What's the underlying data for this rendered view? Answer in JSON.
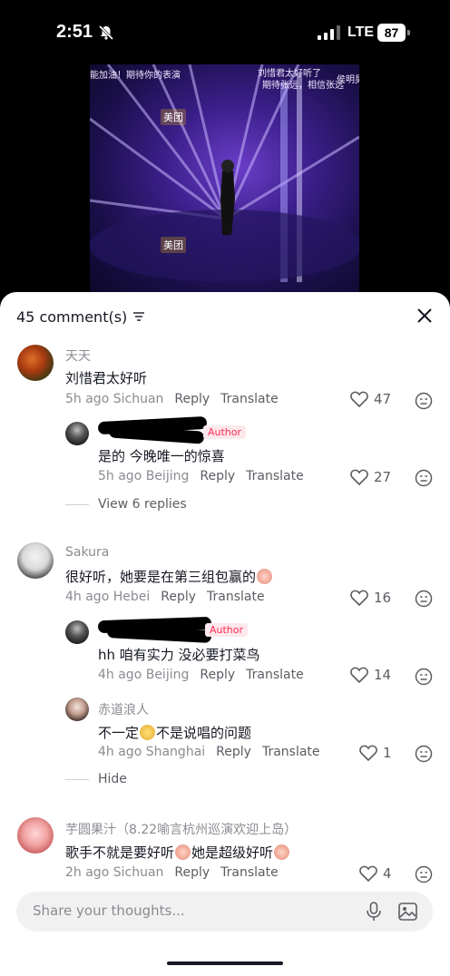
{
  "status_bar": {
    "time": "2:51",
    "network": "LTE",
    "battery": "87"
  },
  "video": {
    "overlay_texts": [
      "能加油！期待你的表演",
      "刘惜君太好听了",
      "期待张远，相信张远",
      "侯明昊",
      "美团",
      "美团"
    ]
  },
  "sheet": {
    "comment_count": "45 comment(s)",
    "input_placeholder": "Share your thoughts..."
  },
  "comments": [
    {
      "username": "天天",
      "text": "刘惜君太好听",
      "time": "5h ago",
      "location": "Sichuan",
      "reply_label": "Reply",
      "translate_label": "Translate",
      "likes": "47",
      "replies": [
        {
          "username": "",
          "badge": "Author",
          "text": "是的 今晚唯一的惊喜",
          "time": "5h ago",
          "location": "Beijing",
          "reply_label": "Reply",
          "translate_label": "Translate",
          "likes": "27"
        }
      ],
      "view_replies": "View 6 replies"
    },
    {
      "username": "Sakura",
      "text": "很好听，她要是在第三组包赢的",
      "time": "4h ago",
      "location": "Hebei",
      "reply_label": "Reply",
      "translate_label": "Translate",
      "likes": "16",
      "replies": [
        {
          "username": "",
          "badge": "Author",
          "text": "hh 咱有实力 没必要打菜鸟",
          "time": "4h ago",
          "location": "Beijing",
          "reply_label": "Reply",
          "translate_label": "Translate",
          "likes": "14"
        },
        {
          "username": "赤道浪人",
          "text_a": "不一定",
          "text_b": "不是说唱的问题",
          "time": "4h ago",
          "location": "Shanghai",
          "reply_label": "Reply",
          "translate_label": "Translate",
          "likes": "1"
        }
      ],
      "hide_label": "Hide"
    },
    {
      "username": "芋圆果汁（8.22喻言杭州巡演欢迎上岛）",
      "text_a": "歌手不就是要好听",
      "text_b": "她是超级好听",
      "time": "2h ago",
      "location": "Sichuan",
      "reply_label": "Reply",
      "translate_label": "Translate",
      "likes": "4"
    }
  ],
  "colors": {
    "accent": "#fe2c55",
    "secondary_text": "#8a8b91",
    "background": "#ffffff"
  }
}
